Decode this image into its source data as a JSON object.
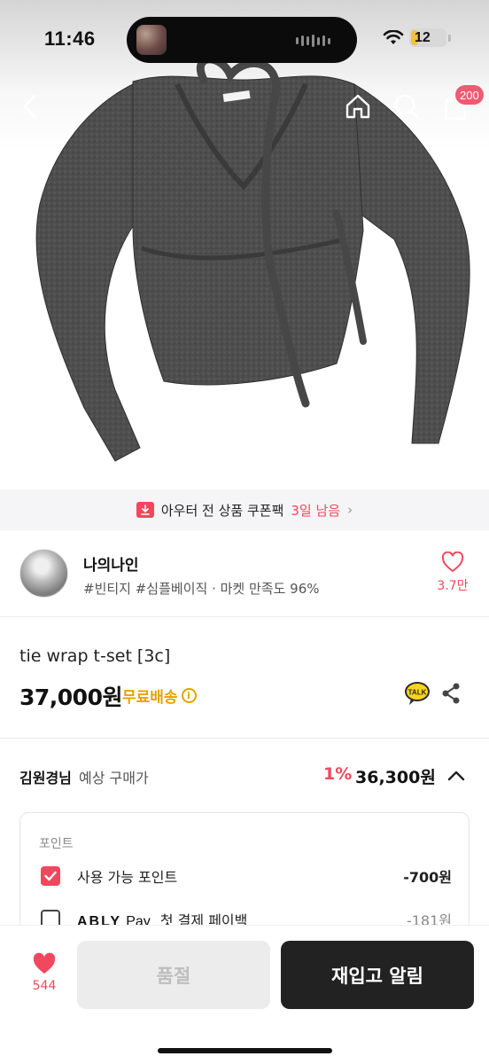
{
  "status_bar": {
    "time": "11:46",
    "battery": "12"
  },
  "nav": {
    "cart_count": "200",
    "icons": [
      "back-icon",
      "home-icon",
      "search-icon",
      "cart-icon"
    ]
  },
  "coupon_banner": {
    "text": "아우터 전 상품 쿠폰팩",
    "highlight": "3일 남음",
    "chevron": "›"
  },
  "seller": {
    "name": "나의나인",
    "tags": "#빈티지 #심플베이직 · 마켓 만족도 96%",
    "like_count": "3.7만"
  },
  "product": {
    "name": "tie wrap t-set [3c]",
    "price": "37,000원",
    "shipping": "무료배송",
    "info_glyph": "i"
  },
  "expected_price": {
    "user": "김원경님",
    "label": "예상 구매가",
    "discount": "1%",
    "price": "36,300원"
  },
  "points": {
    "title": "포인트",
    "rows": [
      {
        "label": "사용 가능 포인트",
        "value": "-700원",
        "checked": true
      },
      {
        "logo": "ABLY",
        "pay": "Pay",
        "label": "첫 결제 페이백",
        "value": "-181원",
        "checked": false
      }
    ]
  },
  "bottom_bar": {
    "wish_count": "544",
    "soldout_label": "품절",
    "restock_label": "재입고 알림"
  },
  "colors": {
    "accent_pink": "#f0485e",
    "free_ship_yellow": "#e6a200",
    "dark_button": "#222222",
    "disabled_button": "#ececec"
  }
}
